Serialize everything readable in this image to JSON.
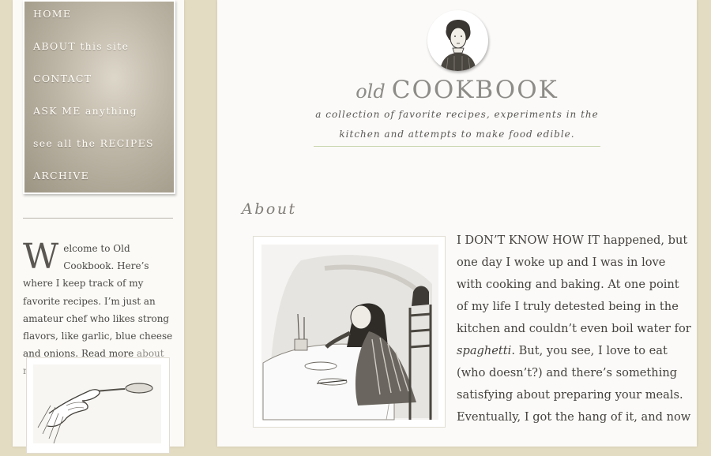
{
  "nav": {
    "items": [
      {
        "label": "HOME"
      },
      {
        "label": "ABOUT this site"
      },
      {
        "label": "CONTACT"
      },
      {
        "label": "ASK ME anything"
      },
      {
        "label": "see all the RECIPES"
      },
      {
        "label": "ARCHIVE"
      }
    ]
  },
  "sidebar": {
    "welcome_dropcap": "W",
    "welcome_text": "elcome to Old Cookbook. Here’s where I keep track of my favorite recipes. I’m just an amateur chef who likes strong flavors, like garlic, blue cheese and onions.",
    "read_more_prefix": "Read more",
    "read_more_link": "about me and this site."
  },
  "site": {
    "title_prefix": "old",
    "title_main": "COOKBOOK",
    "tagline_line1": "a collection of favorite recipes, experiments in the",
    "tagline_line2": "kitchen and attempts to make food edible."
  },
  "about": {
    "heading": "About",
    "p1_before": "I DON’T KNOW HOW IT happened, but one day I woke up and I was in love with cooking and baking. At one point of my life I truly detested being in the kitchen and couldn’t even boil water for ",
    "p1_em": "spaghetti",
    "p1_after": ". But, you see, I love to eat (who doesn’t?) and there’s something satisfying about preparing your meals.",
    "p2": "Eventually, I got the hang of it, and now"
  }
}
